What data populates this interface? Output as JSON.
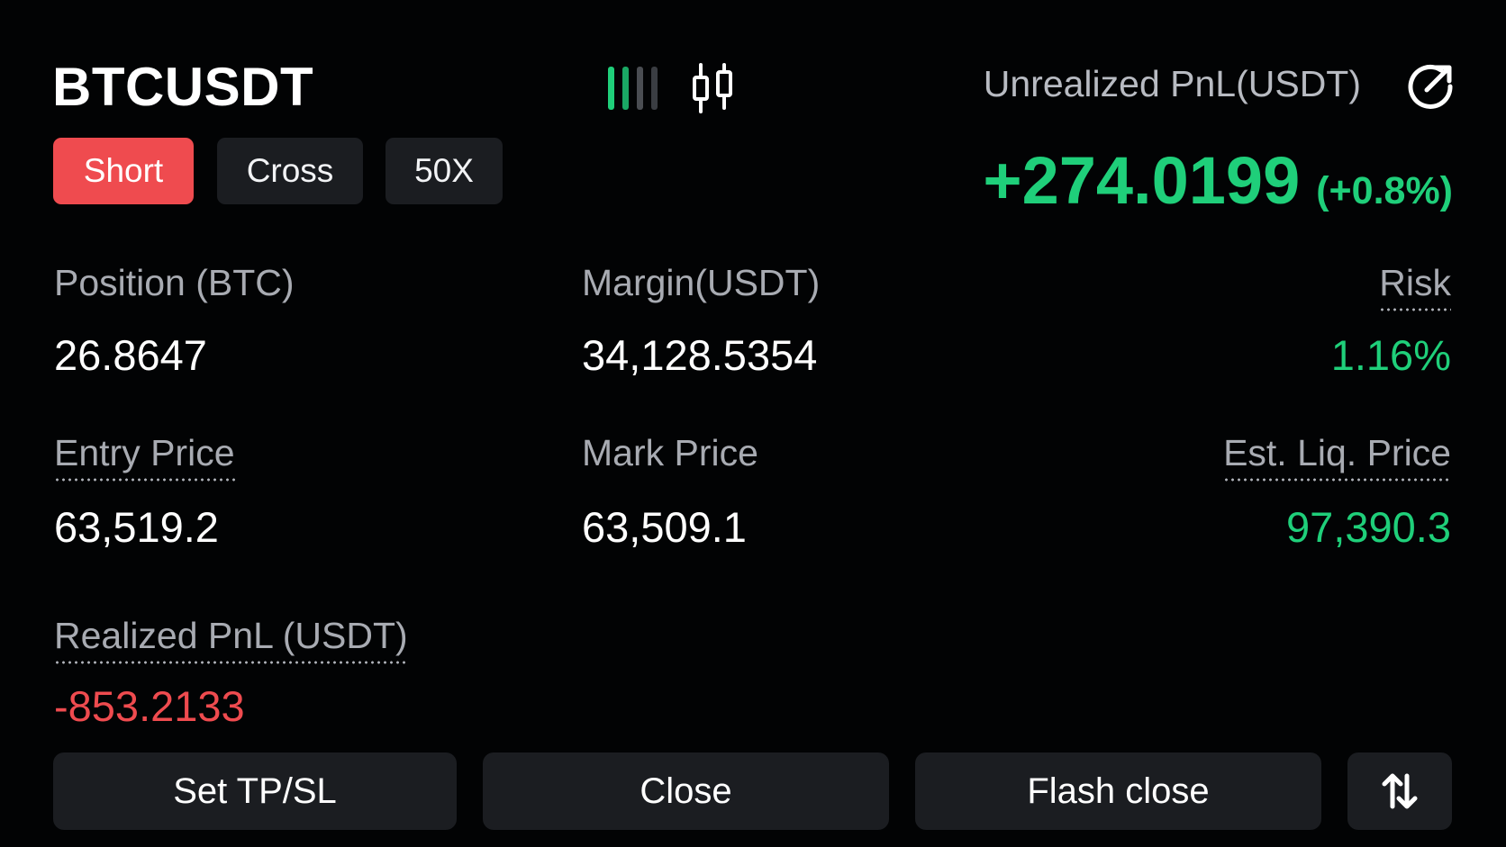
{
  "position": {
    "symbol": "BTCUSDT",
    "tags": {
      "side": "Short",
      "margin_mode": "Cross",
      "leverage": "50X"
    },
    "unrealized_pnl": {
      "label": "Unrealized PnL(USDT)",
      "value": "+274.0199",
      "percent": "(+0.8%)"
    },
    "fields": {
      "size": {
        "label": "Position (BTC)",
        "value": "26.8647"
      },
      "margin": {
        "label": "Margin(USDT)",
        "value": "34,128.5354"
      },
      "risk": {
        "label": "Risk",
        "value": "1.16%"
      },
      "entry_price": {
        "label": "Entry Price",
        "value": "63,519.2"
      },
      "mark_price": {
        "label": "Mark Price",
        "value": "63,509.1"
      },
      "liq_price": {
        "label": "Est. Liq. Price",
        "value": "97,390.3"
      },
      "realized_pnl": {
        "label": "Realized PnL (USDT)",
        "value": "-853.2133"
      }
    }
  },
  "actions": {
    "set_tpsl": "Set TP/SL",
    "close": "Close",
    "flash_close": "Flash close"
  },
  "icons": {
    "depth_chart": "bars-chart-icon",
    "kline_chart": "candlestick-icon",
    "share": "share-icon",
    "reverse": "swap-vertical-icon"
  },
  "colors": {
    "profit": "#1fcf7a",
    "loss": "#ef4b4f",
    "short_tag": "#ef4b4f",
    "button_bg": "#1b1d21",
    "background": "#020304"
  }
}
